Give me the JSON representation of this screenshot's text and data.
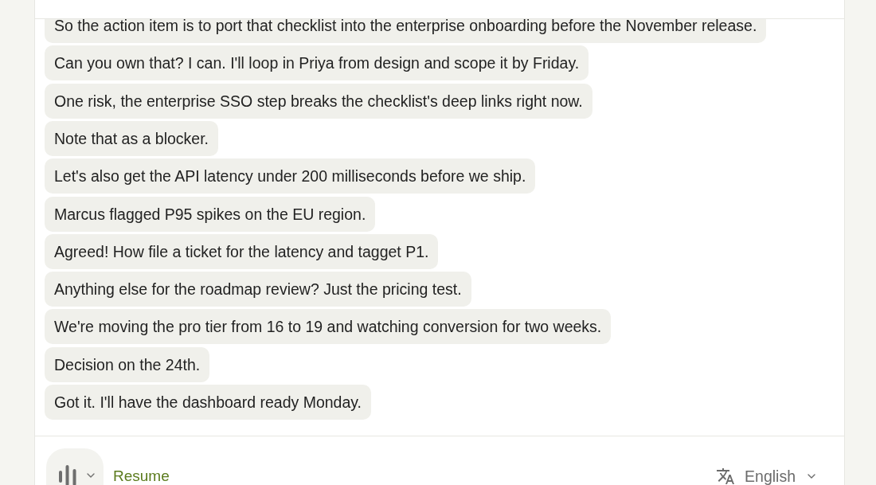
{
  "messages": [
    {
      "text": "So the action item is to port that checklist into the enterprise onboarding before the November release."
    },
    {
      "text": "Can you own that? I can. I'll loop in Priya from design and scope it by Friday."
    },
    {
      "text": "One risk, the enterprise SSO step breaks the checklist's deep links right now."
    },
    {
      "text": "Note that as a blocker."
    },
    {
      "text": "Let's also get the API latency under 200 milliseconds before we ship."
    },
    {
      "text": "Marcus flagged P95 spikes on the EU region."
    },
    {
      "text": "Agreed! How file a ticket for the latency and tagget P1."
    },
    {
      "text": "Anything else for the roadmap review? Just the pricing test."
    },
    {
      "text": "We're moving the pro tier from 16 to 19 and watching conversion for two weeks."
    },
    {
      "text": "Decision on the 24th."
    },
    {
      "text": "Got it. I'll have the dashboard ready Monday."
    }
  ],
  "footer": {
    "resume_label": "Resume",
    "language": "English"
  }
}
